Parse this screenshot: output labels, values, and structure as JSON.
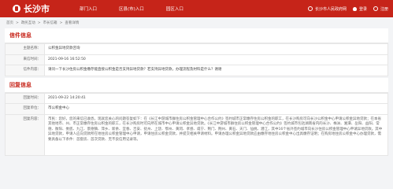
{
  "header": {
    "site_name": "长沙市",
    "nav": [
      "部门入口",
      "区县(市)入口",
      "园区入口"
    ],
    "portal_text": "长沙市人民政府网",
    "login": "登录",
    "register": "注册"
  },
  "breadcrumb": [
    "首页",
    "政民互动",
    "市长信箱",
    "查看详情"
  ],
  "letter": {
    "title": "信件信息",
    "fields": [
      {
        "label": "主题名称：",
        "value": "公积金异地贷款咨询"
      },
      {
        "label": "来信时间：",
        "value": "2021-09-16 16:52:50"
      },
      {
        "label": "信件内容：",
        "value": "请问一下长沙住房公积金缴存能直接公积金是否支持异地贷款？若支持异地贷款，办理流程及材料是什么？谢谢"
      }
    ]
  },
  "reply": {
    "title": "回复信息",
    "fields": [
      {
        "label": "回复时间：",
        "value": "2021-09-22 14:20:41"
      },
      {
        "label": "回复单位：",
        "value": "市公积金中心"
      },
      {
        "label": "回复内容：",
        "value": "市民：您好，您的来信已收悉，现就您关心的问题答复如下：在《长江中游城市群住房公积金管理中心合作公约》签约城市正常缴存住房公积金的职工，在长沙购房可向长沙公积金中心申请公积金异地贷款；在本省其他地市、州、市正常缴存住房公积金的职工，在长沙购房时可向所在城市中心申请公积金异地贷款。《长江中游城市群住房公积金管理中心合作公约》签约城市包括湖南省内的长沙、株洲、湘潭、岳阳、益阳、常德、衡阳、娄底、九江、景德镇、萍乡、新余、宜春、吉安、抚州、上饶、鄂州、黄冈、孝感、咸宁、荆门、荆州、黄石、天门、仙桃、潜江，其中16个省外签约城市向长沙住房公积金管理中心申请异地贷款。其中异地贷款，申请人应向贷款所在地住房公积金管理中心申请，申请住房公积金贷款，并提交相关申请材料。申请办理公积金异地贷款应由缴存地住房公积金中心出具缴存证明；在购房地住房公积金中心办理贷款，需要具备以下条件：首套房、首次贷款、无不良信用记录等。"
      }
    ]
  }
}
